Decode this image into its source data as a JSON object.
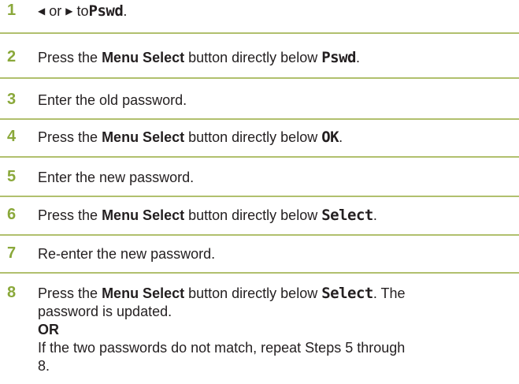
{
  "steps": [
    {
      "number": "1",
      "left_arrow": "◀",
      "or": "or",
      "right_arrow": "▶",
      "to": "to",
      "target": "Pswd",
      "end": "."
    },
    {
      "number": "2",
      "pre": "Press the",
      "bold": "Menu Select",
      "mid": "button directly below",
      "target": "Pswd",
      "end": "."
    },
    {
      "number": "3",
      "text": "Enter the old password."
    },
    {
      "number": "4",
      "pre": "Press the",
      "bold": "Menu Select",
      "mid": "button directly below",
      "target": "OK",
      "end": "."
    },
    {
      "number": "5",
      "text": "Enter the new password."
    },
    {
      "number": "6",
      "pre": "Press the",
      "bold": "Menu Select",
      "mid": "button directly below",
      "target": "Select",
      "end": "."
    },
    {
      "number": "7",
      "text": "Re-enter the new password."
    },
    {
      "number": "8",
      "pre": "Press the",
      "bold": "Menu Select",
      "mid": "button directly below",
      "target": "Select",
      "end": ". The",
      "line2": "password is updated.",
      "or_label": "OR",
      "line4": "If the two passwords do not match, repeat Steps 5 through",
      "line5": "8."
    }
  ],
  "colors": {
    "step_number": "#8aa83a",
    "rule": "#b1c06e",
    "text": "#231f20"
  }
}
